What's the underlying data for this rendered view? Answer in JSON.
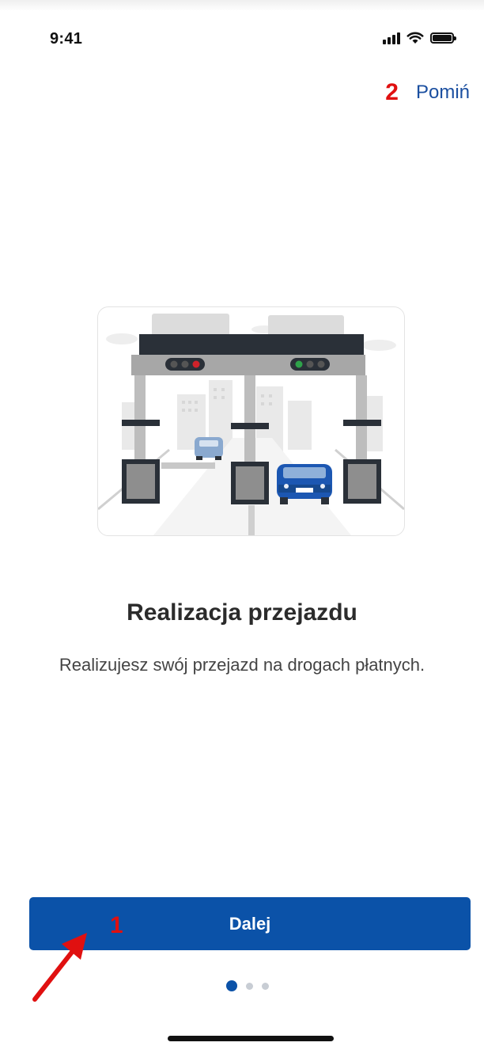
{
  "status_bar": {
    "time": "9:41"
  },
  "header": {
    "skip_label": "Pomiń",
    "annotation": "2"
  },
  "onboarding": {
    "title": "Realizacja przejazdu",
    "description": "Realizujesz swój przejazd na drogach płatnych.",
    "illustration_icon": "toll-gate-illustration"
  },
  "footer": {
    "next_label": "Dalej",
    "annotation": "1",
    "page_indicator": {
      "current": 1,
      "total": 3
    }
  },
  "colors": {
    "primary": "#0b52a8",
    "annotation": "#e01010"
  }
}
